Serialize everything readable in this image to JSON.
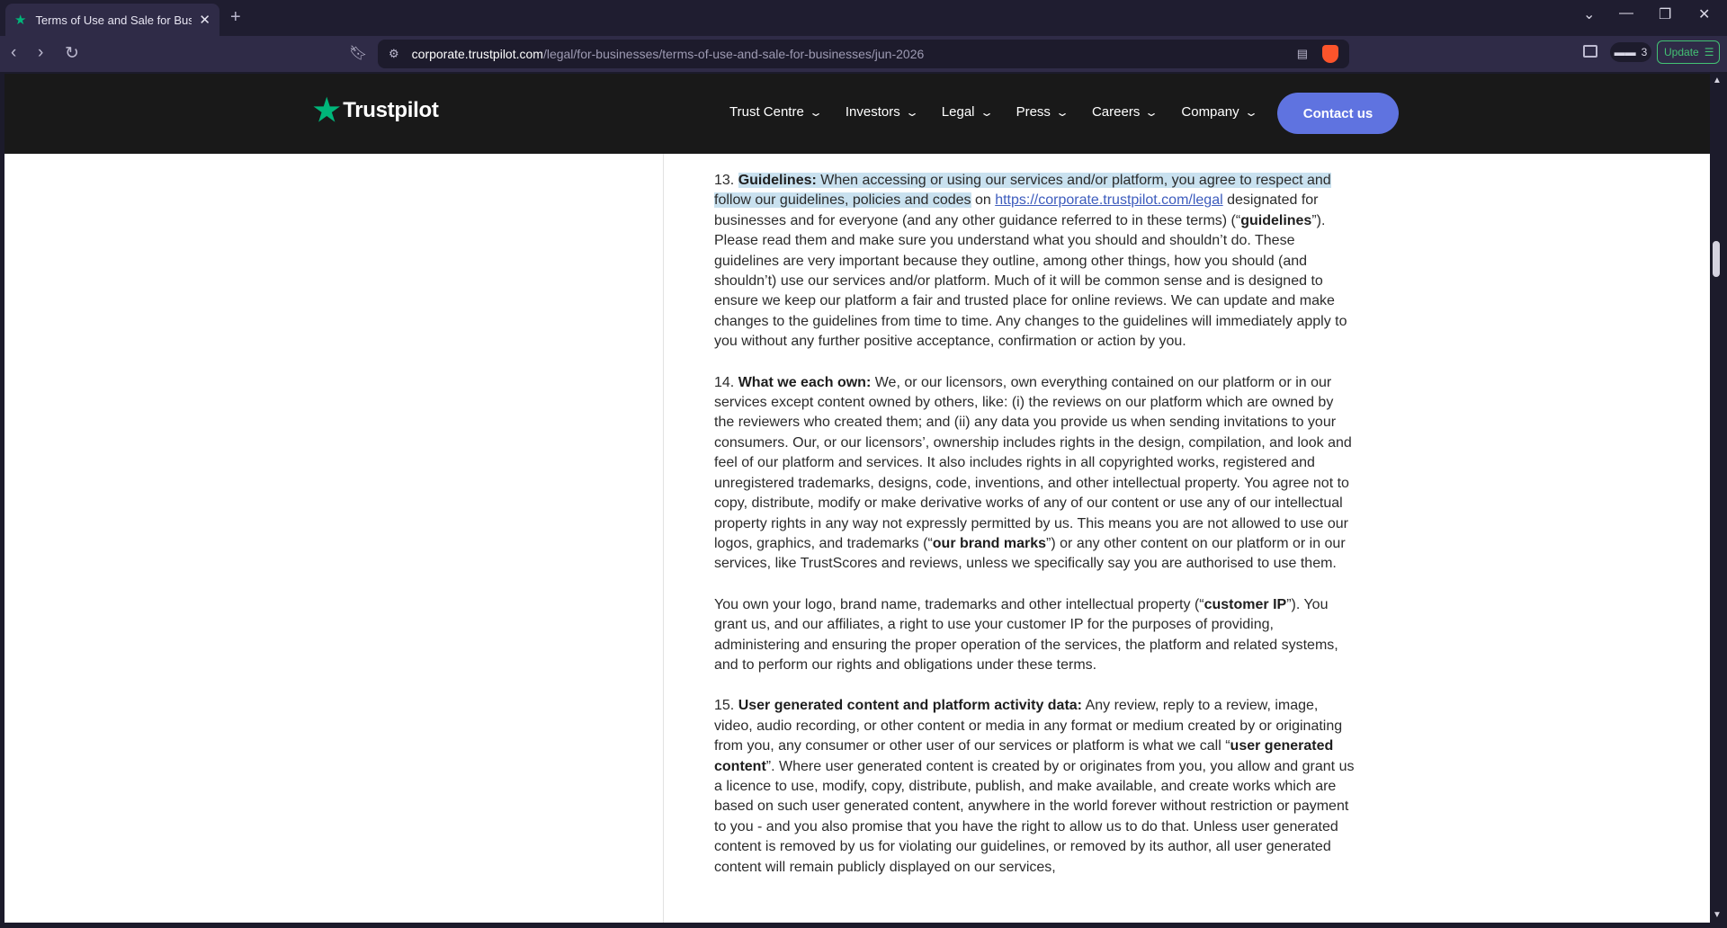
{
  "browser": {
    "tab_title": "Terms of Use and Sale for Businesses",
    "new_tab_symbol": "+",
    "url_host": "corporate.trustpilot.com",
    "url_path": "/legal/for-businesses/terms-of-use-and-sale-for-businesses/jun-2026",
    "wallet_count": "3",
    "update_label": "Update"
  },
  "site": {
    "brand": "Trustpilot",
    "brand_color": "#00b67a",
    "nav": [
      {
        "label": "Trust Centre"
      },
      {
        "label": "Investors"
      },
      {
        "label": "Legal"
      },
      {
        "label": "Press"
      },
      {
        "label": "Careers"
      },
      {
        "label": "Company"
      }
    ],
    "contact_label": "Contact us",
    "contact_color": "#5f73e0"
  },
  "content": {
    "s13": {
      "num": "13.",
      "heading": "Guidelines:",
      "hl_text": " When accessing or using our services and/or platform, you agree to respect and follow our guidelines, policies and codes",
      "on": " on ",
      "link": "https://corporate.trustpilot.com/legal",
      "t1": " designated for businesses and for everyone (and any other guidance referred to in these terms) (“",
      "bold1": "guidelines",
      "t2": "”). Please read them and make sure you understand what you should and shouldn’t do. These guidelines are very important because they outline, among other things, how you should (and shouldn’t) use our services and/or platform. Much of it will be common sense and is designed to ensure we keep our platform a fair and trusted place for online reviews. We can update and make changes to the guidelines from time to time. Any changes to the guidelines will immediately apply to you without any further positive acceptance, confirmation or action by you."
    },
    "s14": {
      "num": "14.",
      "heading": "What we each own:",
      "t1": " We, or our licensors, own everything contained on our platform or in our services except content owned by others, like: (i) the reviews on our platform which are owned by the reviewers who created them; and (ii) any data you provide us when sending invitations to your consumers. Our, or our licensors’, ownership includes rights in the design, compilation, and look and feel of our platform and services. It also includes rights in all copyrighted works, registered and unregistered trademarks, designs, code, inventions, and other intellectual property. You agree not to copy, distribute, modify or make derivative works of any of our content or use any of our intellectual property rights in any way not expressly permitted by us. This means you are not allowed to use our logos, graphics, and trademarks (“",
      "bold1": "our brand marks",
      "t2": "”) or any other content on our platform or in our services, like TrustScores and reviews, unless we specifically say you are authorised to use them."
    },
    "s14b": {
      "t1": "You own your logo, brand name, trademarks and other intellectual property (“",
      "bold1": "customer IP",
      "t2": "”). You grant us, and our affiliates, a right to use your customer IP for the purposes of providing, administering and ensuring the proper operation of the services, the platform and related systems, and to perform our rights and obligations under these terms."
    },
    "s15": {
      "num": "15.",
      "heading": "User generated content and platform activity data:",
      "t1": " Any review, reply to a review, image, video, audio recording, or other content or media in any format or medium created by or originating from you, any consumer or other user of our services or platform is what we call “",
      "bold1": "user generated content",
      "t2": "”. Where user generated content is created by or originates from you, you allow and grant us a licence to use, modify, copy, distribute, publish, and make available, and create works which are based on such user generated content, anywhere in the world forever without restriction or payment to you - and you also promise that you have the right to allow us to do that. Unless user generated content is removed by us for violating our guidelines, or removed by its author, all user generated content will remain publicly displayed on our services,"
    }
  }
}
